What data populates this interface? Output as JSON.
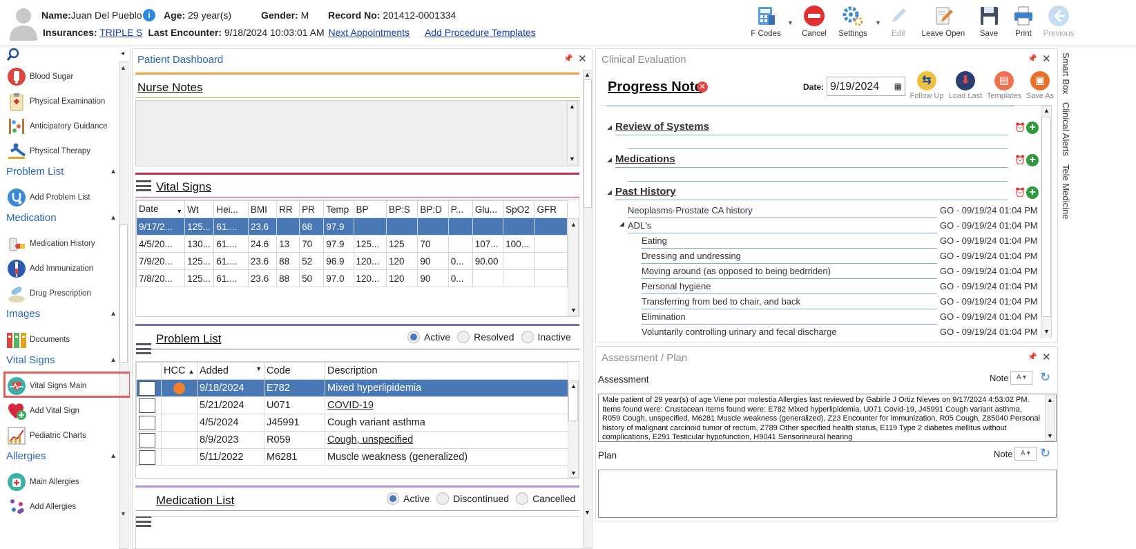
{
  "header": {
    "name_label": "Name:",
    "name_value": "Juan Del Pueblo",
    "age_label": "Age:",
    "age_value": "29 year(s)",
    "gender_label": "Gender:",
    "gender_value": "M",
    "record_label": "Record No:",
    "record_value": "201412-0001334",
    "insurances_label": "Insurances:",
    "insurances_value": "TRIPLE S",
    "last_encounter_label": "Last Encounter:",
    "last_encounter_value": "9/18/2024 10:03:01 AM",
    "next_appointments": "Next Appointments",
    "add_procedure_templates": "Add Procedure Templates"
  },
  "toolbar": {
    "fcodes": "F Codes",
    "cancel": "Cancel",
    "settings": "Settings",
    "edit": "Edit",
    "leave_open": "Leave Open",
    "save": "Save",
    "print": "Print",
    "previous": "Previous"
  },
  "leftnav": {
    "items_top": [
      "Blood Sugar",
      "Physical Examination",
      "Anticipatory Guidance",
      "Physical Therapy"
    ],
    "problem_list_head": "Problem List",
    "problem_list_items": [
      "Add Problem List"
    ],
    "medication_head": "Medication",
    "medication_items": [
      "Medication History",
      "Add Immunization",
      "Drug Prescription"
    ],
    "images_head": "Images",
    "images_items": [
      "Documents"
    ],
    "vital_signs_head": "Vital Signs",
    "vital_signs_items": [
      "Vital Signs Main",
      "Add Vital Sign",
      "Pediatric Charts"
    ],
    "allergies_head": "Allergies",
    "allergies_items": [
      "Main Allergies",
      "Add Allergies"
    ]
  },
  "dashboard": {
    "title": "Patient Dashboard",
    "nurse_notes": "Nurse Notes",
    "vital_signs": "Vital Signs",
    "vital_columns": [
      "Date",
      "Wt",
      "Hei...",
      "BMI",
      "RR",
      "PR",
      "Temp",
      "BP",
      "BP:S",
      "BP:D",
      "P...",
      "Glu...",
      "SpO2",
      "GFR"
    ],
    "vital_rows": [
      [
        "9/17/2...",
        "125...",
        "61....",
        "23.6",
        "",
        "68",
        "97.9",
        "",
        "",
        "",
        "",
        "",
        "",
        ""
      ],
      [
        "4/5/20...",
        "130...",
        "61....",
        "24.6",
        "13",
        "70",
        "97.9",
        "125...",
        "125",
        "70",
        "",
        "107...",
        "100...",
        ""
      ],
      [
        "7/9/20...",
        "125...",
        "61....",
        "23.6",
        "88",
        "52",
        "96.9",
        "120...",
        "120",
        "90",
        "0...",
        "90.00",
        "",
        ""
      ],
      [
        "7/8/20...",
        "125...",
        "61....",
        "23.6",
        "88",
        "50",
        "97.0",
        "120...",
        "120",
        "90",
        "0...",
        "",
        "",
        ""
      ]
    ],
    "problem_list": "Problem List",
    "problem_filters": [
      "Active",
      "Resolved",
      "Inactive"
    ],
    "problem_columns": [
      "HCC",
      "Added",
      "Code",
      "Description"
    ],
    "problem_rows": [
      {
        "added": "9/18/2024",
        "code": "E782",
        "desc": "Mixed hyperlipidemia"
      },
      {
        "added": "5/21/2024",
        "code": "U071",
        "desc": "COVID-19"
      },
      {
        "added": "4/5/2024",
        "code": "J45991",
        "desc": "Cough variant asthma"
      },
      {
        "added": "8/9/2023",
        "code": "R059",
        "desc": "Cough, unspecified"
      },
      {
        "added": "5/11/2022",
        "code": "M6281",
        "desc": "Muscle weakness (generalized)"
      }
    ],
    "medication_list": "Medication List",
    "medication_filters": [
      "Active",
      "Discontinued",
      "Cancelled"
    ]
  },
  "clinical": {
    "title": "Clinical Evaluation",
    "progress_note": "Progress Note",
    "date_label": "Date:",
    "date_value": "9/19/2024",
    "actions": [
      "Follow Up",
      "Load Last",
      "Templates",
      "Save As"
    ],
    "sections": [
      "Review of Systems",
      "Medications",
      "Past History"
    ],
    "history_rows": [
      {
        "label": "Neoplasms-Prostate CA history",
        "stamp": "GO - 09/19/24 01:04 PM"
      },
      {
        "label": "ADL's",
        "stamp": "GO - 09/19/24 01:04 PM"
      },
      {
        "label": "Eating",
        "stamp": "GO - 09/19/24 01:04 PM"
      },
      {
        "label": "Dressing and undressing",
        "stamp": "GO - 09/19/24 01:04 PM"
      },
      {
        "label": "Moving around (as opposed to being bedrriden)",
        "stamp": "GO - 09/19/24 01:04 PM"
      },
      {
        "label": "Personal hygiene",
        "stamp": "GO - 09/19/24 01:04 PM"
      },
      {
        "label": "Transferring from bed to chair, and back",
        "stamp": "GO - 09/19/24 01:04 PM"
      },
      {
        "label": "Elimination",
        "stamp": "GO - 09/19/24 01:04 PM"
      },
      {
        "label": "Voluntarily controlling urinary and fecal discharge",
        "stamp": "GO - 09/19/24 01:04 PM"
      }
    ]
  },
  "assessment": {
    "title": "Assessment / Plan",
    "assessment_label": "Assessment",
    "note_label": "Note",
    "assessment_text": "Male patient of 29 year(s) of age Viene por molestia     Allergies last reviewed by Gabirle J Ortiz Nieves on 9/17/2024 4:53:02 PM.    Items found were:  Crustacean  Items found were:  E782 Mixed hyperlipidemia, U071 Covid-19, J45991 Cough variant asthma, R059 Cough, unspecified, M6281 Muscle weakness (generalized), Z23 Encounter for immunization, R05 Cough, Z85040 Personal history of malignant carcinoid tumor of rectum, Z789 Other specified health status, E119 Type 2 diabetes mellitus without complications, E291 Testicular hypofunction, H9041 Sensorineural hearing",
    "plan_label": "Plan",
    "plan_note_label": "Note"
  },
  "sidebar_right": [
    "Smart Box",
    "Clinical Alerts",
    "Tele Medicine"
  ],
  "colors": {
    "accent": "#2a66b8",
    "selected_row": "#4a78b4",
    "highlight_box": "#e06060"
  }
}
